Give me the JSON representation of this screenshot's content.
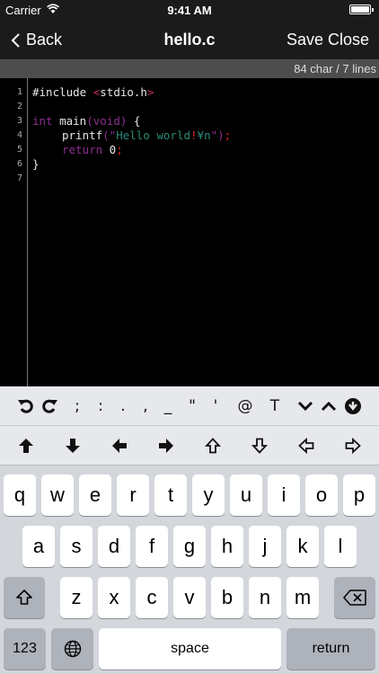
{
  "status_bar": {
    "carrier": "Carrier",
    "time": "9:41 AM",
    "battery": ""
  },
  "nav": {
    "back_label": "Back",
    "title": "hello.c",
    "save_label": "Save",
    "close_label": "Close"
  },
  "info": {
    "stats": "84 char / 7 lines"
  },
  "editor": {
    "line_numbers": [
      "1",
      "2",
      "3",
      "4",
      "5",
      "6",
      "7"
    ],
    "lines": {
      "l1": {
        "directive": "#include ",
        "ang_open": "<",
        "header": "stdio.h",
        "ang_close": ">"
      },
      "l3": {
        "kw": "int",
        "mid": " main",
        "args": "(void)",
        "brace": " {"
      },
      "l4": {
        "fn": "printf",
        "open": "(\"",
        "text": "Hello world",
        "bang": "!",
        "esc": "¥n",
        "close": "\")",
        "semi": ";"
      },
      "l5": {
        "kw": "return",
        "val": " 0",
        "semi": ";"
      },
      "l6": {
        "brace": "}"
      }
    }
  },
  "toolbar_row1": [
    {
      "name": "undo-icon",
      "label": ""
    },
    {
      "name": "redo-icon",
      "label": ""
    },
    {
      "name": "semicolon-key",
      "label": ";"
    },
    {
      "name": "colon-key",
      "label": ":"
    },
    {
      "name": "period-key",
      "label": "."
    },
    {
      "name": "comma-key",
      "label": ","
    },
    {
      "name": "underscore-key",
      "label": "_"
    },
    {
      "name": "double-quote-key",
      "label": "\""
    },
    {
      "name": "single-quote-key",
      "label": "'"
    },
    {
      "name": "at-key",
      "label": "@"
    },
    {
      "name": "t-key",
      "label": "T"
    }
  ],
  "keyboard": {
    "row_q": [
      "q",
      "w",
      "e",
      "r",
      "t",
      "y",
      "u",
      "i",
      "o",
      "p"
    ],
    "row_a": [
      "a",
      "s",
      "d",
      "f",
      "g",
      "h",
      "j",
      "k",
      "l"
    ],
    "row_z": [
      "z",
      "x",
      "c",
      "v",
      "b",
      "n",
      "m"
    ],
    "numbers_label": "123",
    "space_label": "space",
    "return_label": "return"
  }
}
